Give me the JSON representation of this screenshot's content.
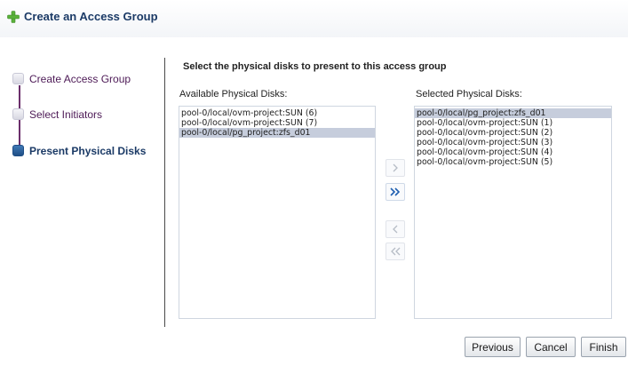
{
  "title": "Create an Access Group",
  "steps": [
    {
      "label": "Create Access Group",
      "current": false
    },
    {
      "label": "Select Initiators",
      "current": false
    },
    {
      "label": "Present Physical Disks",
      "current": true
    }
  ],
  "instruction": "Select the physical disks to present to this access group",
  "available": {
    "label": "Available Physical Disks:",
    "items": [
      {
        "text": "pool-0/local/ovm-project:SUN (6)",
        "selected": false
      },
      {
        "text": "pool-0/local/ovm-project:SUN (7)",
        "selected": false
      },
      {
        "text": "pool-0/local/pg_project:zfs_d01",
        "selected": true
      }
    ]
  },
  "selected": {
    "label": "Selected Physical Disks:",
    "items": [
      {
        "text": "pool-0/local/pg_project:zfs_d01",
        "selected": true
      },
      {
        "text": "pool-0/local/ovm-project:SUN (1)",
        "selected": false
      },
      {
        "text": "pool-0/local/ovm-project:SUN (2)",
        "selected": false
      },
      {
        "text": "pool-0/local/ovm-project:SUN (3)",
        "selected": false
      },
      {
        "text": "pool-0/local/ovm-project:SUN (4)",
        "selected": false
      },
      {
        "text": "pool-0/local/ovm-project:SUN (5)",
        "selected": false
      }
    ]
  },
  "shuttle_icons": [
    "move-right-icon",
    "move-all-right-icon",
    "move-left-icon",
    "move-all-left-icon"
  ],
  "buttons": {
    "previous": "Previous",
    "cancel": "Cancel",
    "finish": "Finish"
  },
  "colors": {
    "header_text": "#1b3a66",
    "step_text": "#4d1a56",
    "selection": "#c6cddc",
    "plus_icon": "#5ab13a",
    "train_current": "#2a5d98"
  }
}
